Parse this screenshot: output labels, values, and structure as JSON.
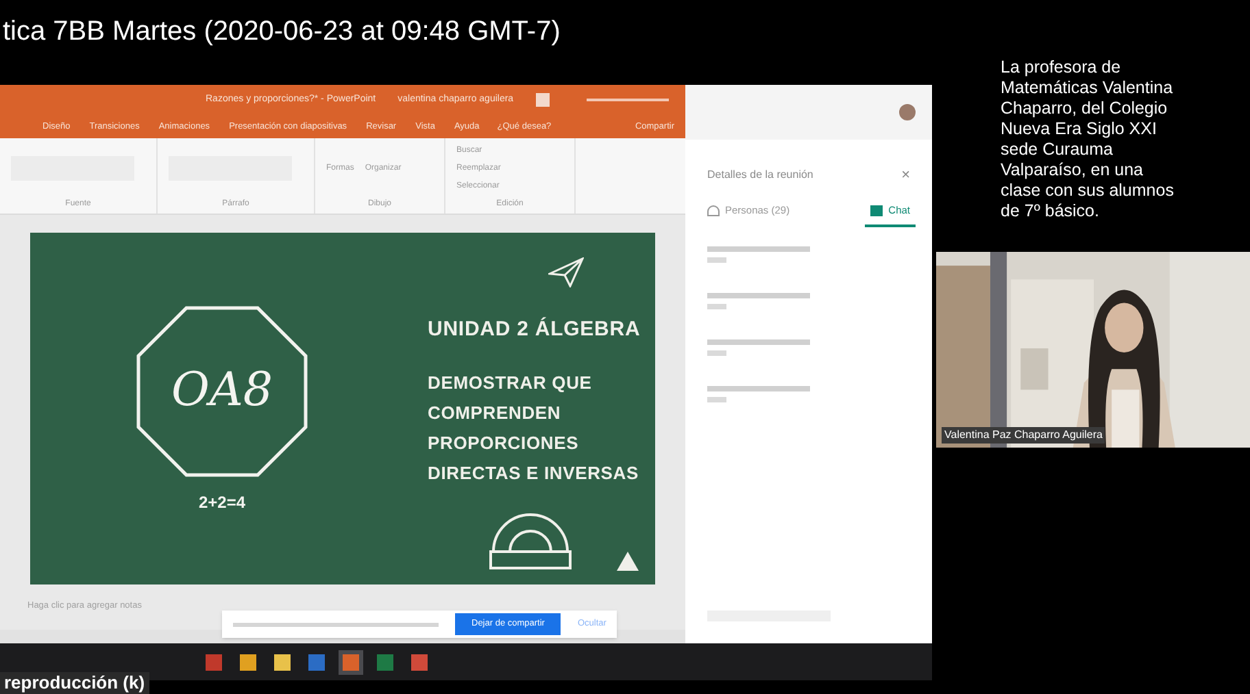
{
  "recording_title": "tica 7BB Martes (2020-06-23 at 09:48 GMT-7)",
  "powerpoint": {
    "title": "Razones y proporciones?* - PowerPoint",
    "user": "valentina chaparro aguilera",
    "ribbon_tabs": [
      {
        "label": "Diseño",
        "selected": false
      },
      {
        "label": "Transiciones",
        "selected": false
      },
      {
        "label": "Animaciones",
        "selected": false
      },
      {
        "label": "Presentación con diapositivas",
        "selected": false
      },
      {
        "label": "Revisar",
        "selected": false
      },
      {
        "label": "Vista",
        "selected": false
      },
      {
        "label": "Ayuda",
        "selected": false
      }
    ],
    "search_hint": "¿Qué desea?",
    "share": "Compartir",
    "groups": [
      "Fuente",
      "Párrafo",
      "Dibujo",
      "Edición"
    ],
    "drawing_buttons": [
      "Formas",
      "Organizar"
    ],
    "editing_buttons": [
      "Buscar",
      "Reemplazar",
      "Seleccionar"
    ],
    "slide": {
      "badge": "OA8",
      "formula": "2+2=4",
      "heading": "UNIDAD 2 ÁLGEBRA",
      "lines": [
        "DEMOSTRAR QUE",
        "COMPRENDEN",
        "PROPORCIONES",
        "DIRECTAS E INVERSAS"
      ]
    },
    "notes_placeholder": "Haga clic para agregar notas"
  },
  "share_bar": {
    "stop": "Dejar de compartir",
    "hide": "Ocultar"
  },
  "meeting_panel": {
    "title": "Detalles de la reunión",
    "tabs": [
      {
        "label": "Personas (29)",
        "kind": "people",
        "selected": false
      },
      {
        "label": "Chat",
        "kind": "chat",
        "selected": true
      }
    ],
    "close": "×",
    "messages": [
      {
        "kind": "blurred"
      },
      {
        "kind": "blurred"
      },
      {
        "kind": "blurred"
      },
      {
        "kind": "blurred"
      }
    ]
  },
  "taskbar": {
    "apps": [
      {
        "color": "#c0392b",
        "active": false
      },
      {
        "color": "#e0a020",
        "active": false
      },
      {
        "color": "#e8c14a",
        "active": false
      },
      {
        "color": "#2b6cc4",
        "active": false
      },
      {
        "color": "#d9622b",
        "active": true
      },
      {
        "color": "#1e7a45",
        "active": false
      },
      {
        "color": "#d04a3a",
        "active": false
      }
    ]
  },
  "caption": "La profesora de Matemáticas Valentina Chaparro, del Colegio Nueva Era Siglo XXI sede Curauma Valparaíso, en una clase con sus alumnos de 7º básico.",
  "camera": {
    "name": "Valentina Paz Chaparro Aguilera"
  },
  "player_hint": "reproducción (k)"
}
